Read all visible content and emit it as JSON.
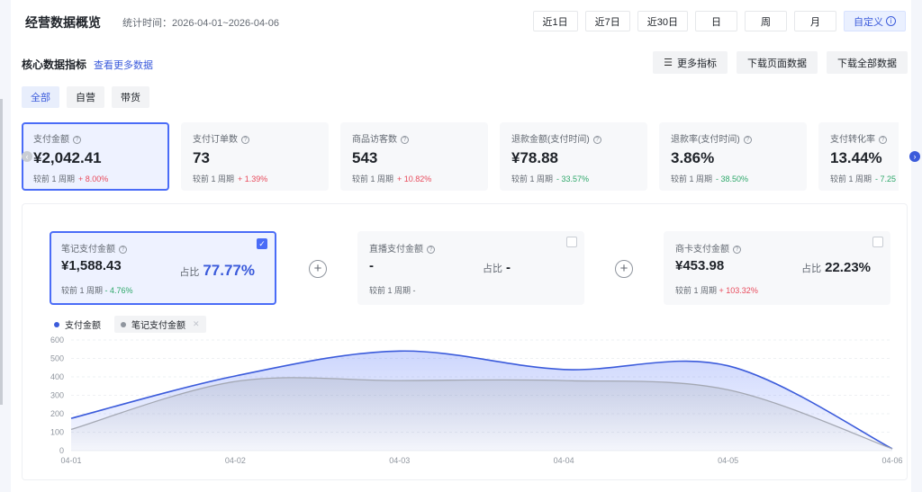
{
  "header": {
    "title": "经营数据概览",
    "stat_range": "统计时间：2026-04-01~2026-04-06",
    "range_buttons": [
      "近1日",
      "近7日",
      "近30日",
      "日",
      "周",
      "月"
    ],
    "custom_label": "自定义",
    "custom_icon": "info-icon"
  },
  "core": {
    "title": "核心数据指标",
    "more_link": "查看更多数据",
    "more_metrics": "更多指标",
    "download_page": "下载页面数据",
    "download_all": "下载全部数据"
  },
  "tabs": [
    "全部",
    "自营",
    "带货"
  ],
  "kpis": [
    {
      "label": "支付金额",
      "value": "¥2,042.41",
      "compare": "较前 1 周期",
      "delta": "+ 8.00%",
      "dir": "up",
      "selected": true
    },
    {
      "label": "支付订单数",
      "value": "73",
      "compare": "较前 1 周期",
      "delta": "+ 1.39%",
      "dir": "up"
    },
    {
      "label": "商品访客数",
      "value": "543",
      "compare": "较前 1 周期",
      "delta": "+ 10.82%",
      "dir": "up"
    },
    {
      "label": "退款金额(支付时间)",
      "value": "¥78.88",
      "compare": "较前 1 周期",
      "delta": "- 33.57%",
      "dir": "down"
    },
    {
      "label": "退款率(支付时间)",
      "value": "3.86%",
      "compare": "较前 1 周期",
      "delta": "- 38.50%",
      "dir": "down"
    },
    {
      "label": "支付转化率",
      "value": "13.44%",
      "compare": "较前 1 周期",
      "delta": "- 7.25",
      "dir": "down"
    }
  ],
  "breakdown": [
    {
      "label": "笔记支付金额",
      "value": "¥1,588.43",
      "ratio_label": "占比",
      "ratio": "77.77%",
      "compare": "较前 1 周期",
      "delta": "- 4.76%",
      "dir": "down",
      "checked": true
    },
    {
      "label": "直播支付金额",
      "value": "-",
      "ratio_label": "占比",
      "ratio": "-",
      "compare": "较前 1 周期",
      "delta": "-",
      "dir": "none",
      "checked": false
    },
    {
      "label": "商卡支付金额",
      "value": "¥453.98",
      "ratio_label": "占比",
      "ratio": "22.23%",
      "compare": "较前 1 周期",
      "delta": "+ 103.32%",
      "dir": "up",
      "checked": false
    }
  ],
  "colors": {
    "accent": "#3b5bdb",
    "series1": "#4a6cf7",
    "series2": "#a4a8b3",
    "up": "#e84b5c",
    "down": "#2fa86b"
  },
  "chart_data": {
    "type": "area",
    "x": [
      "04-01",
      "04-02",
      "04-03",
      "04-04",
      "04-05",
      "04-06"
    ],
    "series": [
      {
        "name": "支付金额",
        "values": [
          175,
          405,
          540,
          440,
          460,
          10
        ]
      },
      {
        "name": "笔记支付金额",
        "values": [
          115,
          375,
          380,
          380,
          330,
          10
        ]
      }
    ],
    "ylim": [
      0,
      600
    ],
    "yticks": [
      0,
      100,
      200,
      300,
      400,
      500,
      600
    ],
    "grid": true,
    "legend_position": "top-left"
  }
}
